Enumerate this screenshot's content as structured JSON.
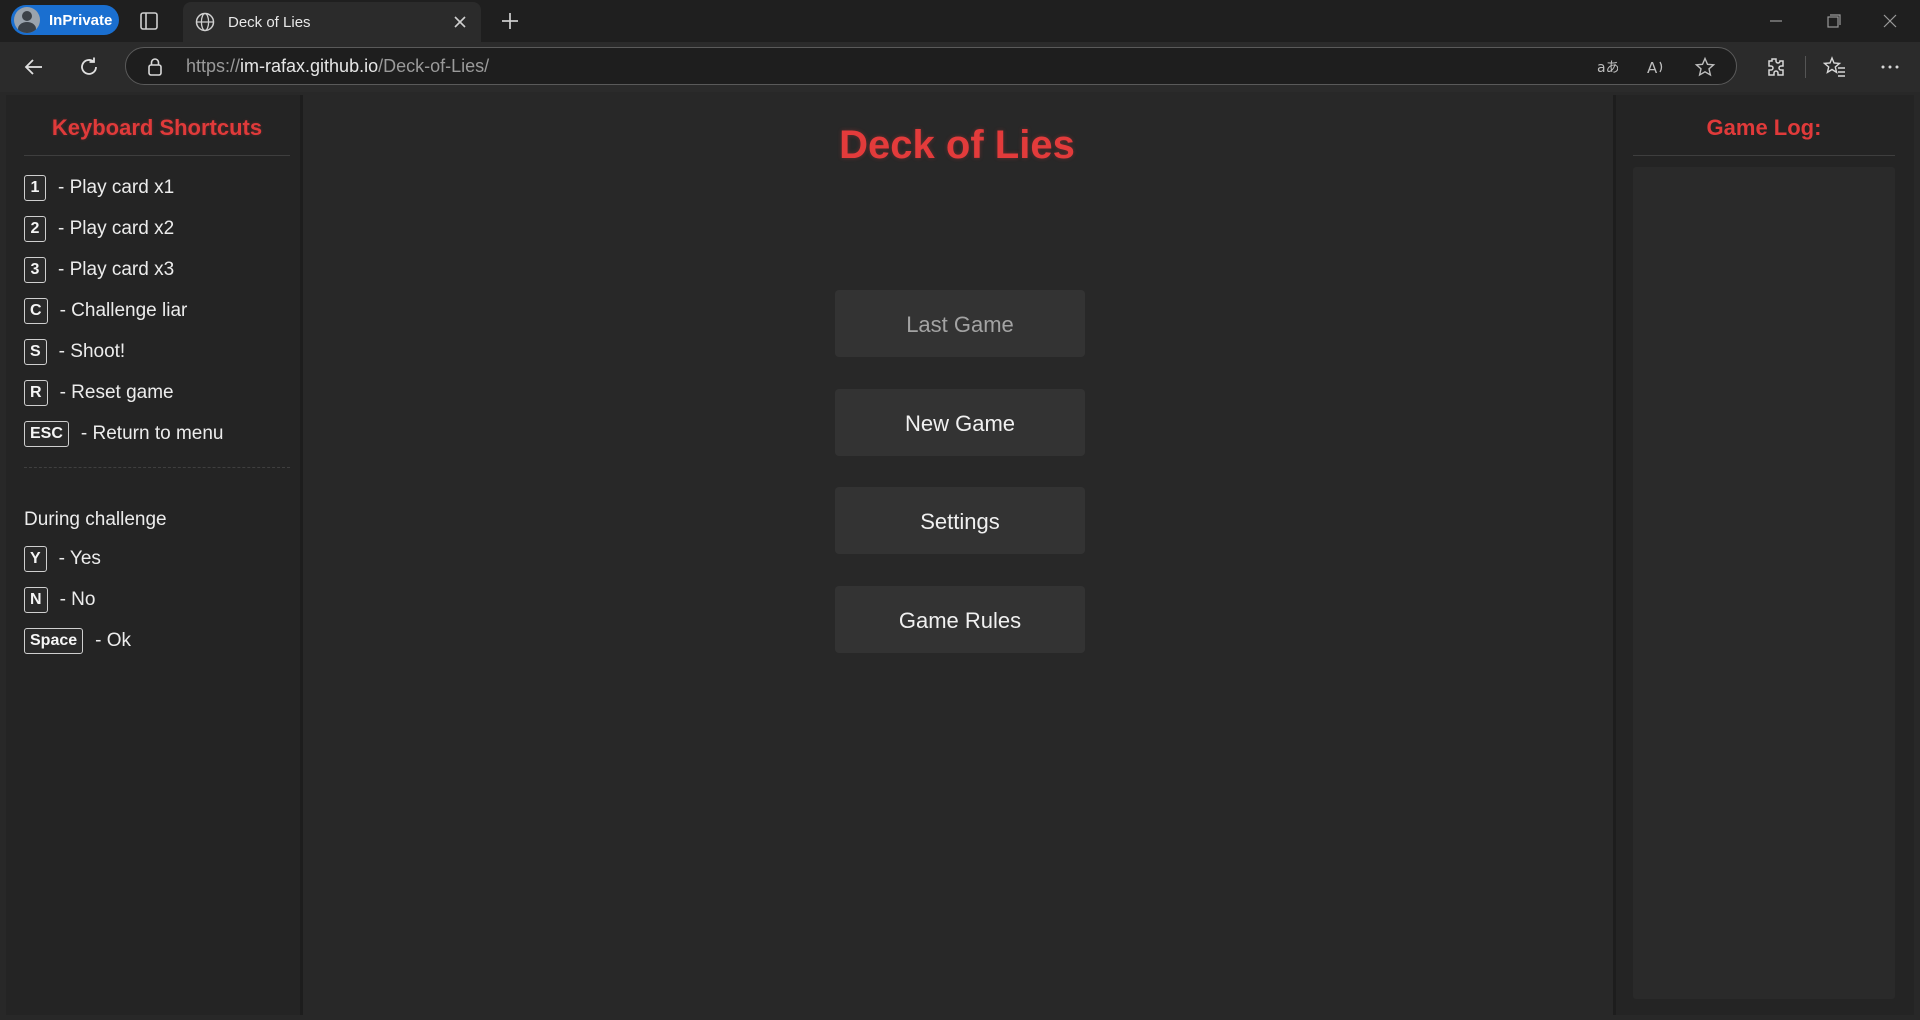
{
  "browser": {
    "profile_label": "InPrivate",
    "tab_title": "Deck of Lies",
    "url_prefix": "https://",
    "url_host": "im-rafax.github.io",
    "url_path": "/Deck-of-Lies/",
    "accent": "#1a6fd0"
  },
  "left_panel": {
    "title": "Keyboard Shortcuts",
    "shortcuts": [
      {
        "key": "1",
        "label": "- Play card x1"
      },
      {
        "key": "2",
        "label": "- Play card x2"
      },
      {
        "key": "3",
        "label": "- Play card x3"
      },
      {
        "key": "C",
        "label": "- Challenge liar"
      },
      {
        "key": "S",
        "label": "- Shoot!"
      },
      {
        "key": "R",
        "label": "- Reset game"
      },
      {
        "key": "ESC",
        "label": "- Return to menu"
      }
    ],
    "challenge_heading": "During challenge",
    "challenge_shortcuts": [
      {
        "key": "Y",
        "label": "- Yes"
      },
      {
        "key": "N",
        "label": "- No"
      },
      {
        "key": "Space",
        "label": "- Ok"
      }
    ]
  },
  "main": {
    "title": "Deck of Lies",
    "title_color": "#e33b3b",
    "buttons": {
      "last_game": "Last Game",
      "new_game": "New Game",
      "settings": "Settings",
      "game_rules": "Game Rules"
    }
  },
  "right_panel": {
    "title": "Game Log:"
  }
}
